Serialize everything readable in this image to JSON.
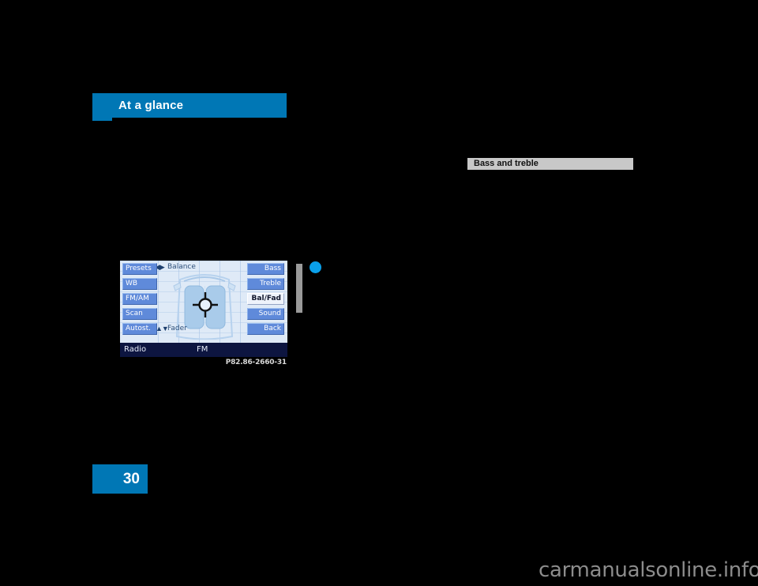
{
  "chapter": {
    "header_title": "At a glance",
    "header_color": "#0077b5"
  },
  "section": {
    "heading": "Bass and treble",
    "heading_bg": "#c8c8c8"
  },
  "figure": {
    "caption": "P82.86-2660-31",
    "screen": {
      "left_buttons": [
        {
          "label": "Presets"
        },
        {
          "label": "WB"
        },
        {
          "label": "FM/AM"
        },
        {
          "label": "Scan"
        },
        {
          "label": "Autost."
        }
      ],
      "right_buttons": [
        {
          "label": "Bass",
          "active": false
        },
        {
          "label": "Treble",
          "active": false
        },
        {
          "label": "Bal/Fad",
          "active": true
        },
        {
          "label": "Sound",
          "active": false
        },
        {
          "label": "Back",
          "active": false
        }
      ],
      "balance_label": "Balance",
      "balance_arrows": "◀▶",
      "fader_label": "Fader",
      "fader_arrows": "▲▼",
      "status": {
        "source": "Radio",
        "band": "FM"
      },
      "screen_bg": "#dfeaf7",
      "button_color": "#5f8ada",
      "active_button_color": "#eef3fb",
      "status_bar_color": "#0d1540"
    }
  },
  "margin_marker": {
    "rule_color": "#9a9a9a",
    "dot_color": "#0aa0ea"
  },
  "page": {
    "number": "30",
    "block_color": "#0077b5"
  },
  "watermark": {
    "text": "carmanualsonline.info"
  }
}
